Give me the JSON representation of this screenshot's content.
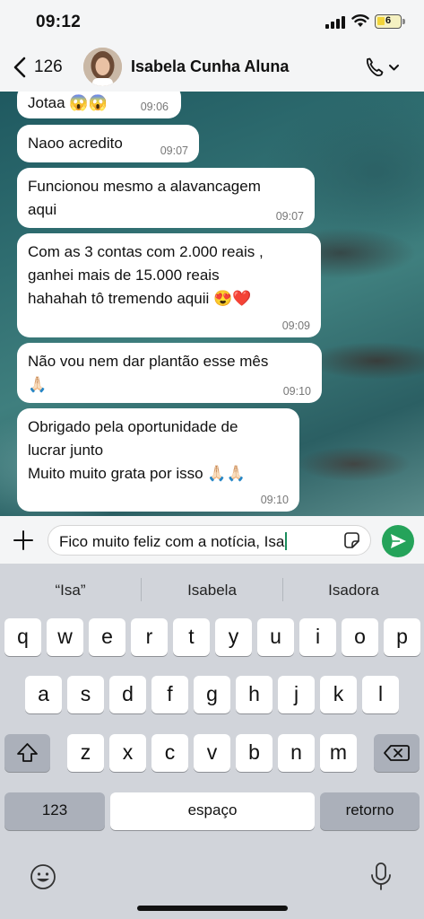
{
  "status": {
    "time": "09:12",
    "battery": "6"
  },
  "header": {
    "back_count": "126",
    "contact_name": "Isabela Cunha Aluna"
  },
  "messages": [
    {
      "text": "Jotaa 😱😱",
      "time": "09:06"
    },
    {
      "text": "Naoo acredito",
      "time": "09:07"
    },
    {
      "text": "Funcionou mesmo a alavancagem\naqui",
      "time": "09:07"
    },
    {
      "text": "Com as 3 contas com 2.000 reais ,\nganhei mais de 15.000 reais\nhahahah tô tremendo aquii 😍❤️",
      "time": "09:09"
    },
    {
      "text": "Não vou nem dar plantão esse mês\n🙏🏻",
      "time": "09:10"
    },
    {
      "text": "Obrigado pela oportunidade de\nlucrar junto\nMuito muito grata por isso 🙏🏻🙏🏻",
      "time": "09:10"
    }
  ],
  "composer": {
    "value": "Fico muito feliz com a notícia, Isa"
  },
  "keyboard": {
    "suggestions": [
      "“Isa”",
      "Isabela",
      "Isadora"
    ],
    "row1": [
      "q",
      "w",
      "e",
      "r",
      "t",
      "y",
      "u",
      "i",
      "o",
      "p"
    ],
    "row2": [
      "a",
      "s",
      "d",
      "f",
      "g",
      "h",
      "j",
      "k",
      "l"
    ],
    "row3": [
      "z",
      "x",
      "c",
      "v",
      "b",
      "n",
      "m"
    ],
    "numbers_label": "123",
    "space_label": "espaço",
    "return_label": "retorno"
  }
}
